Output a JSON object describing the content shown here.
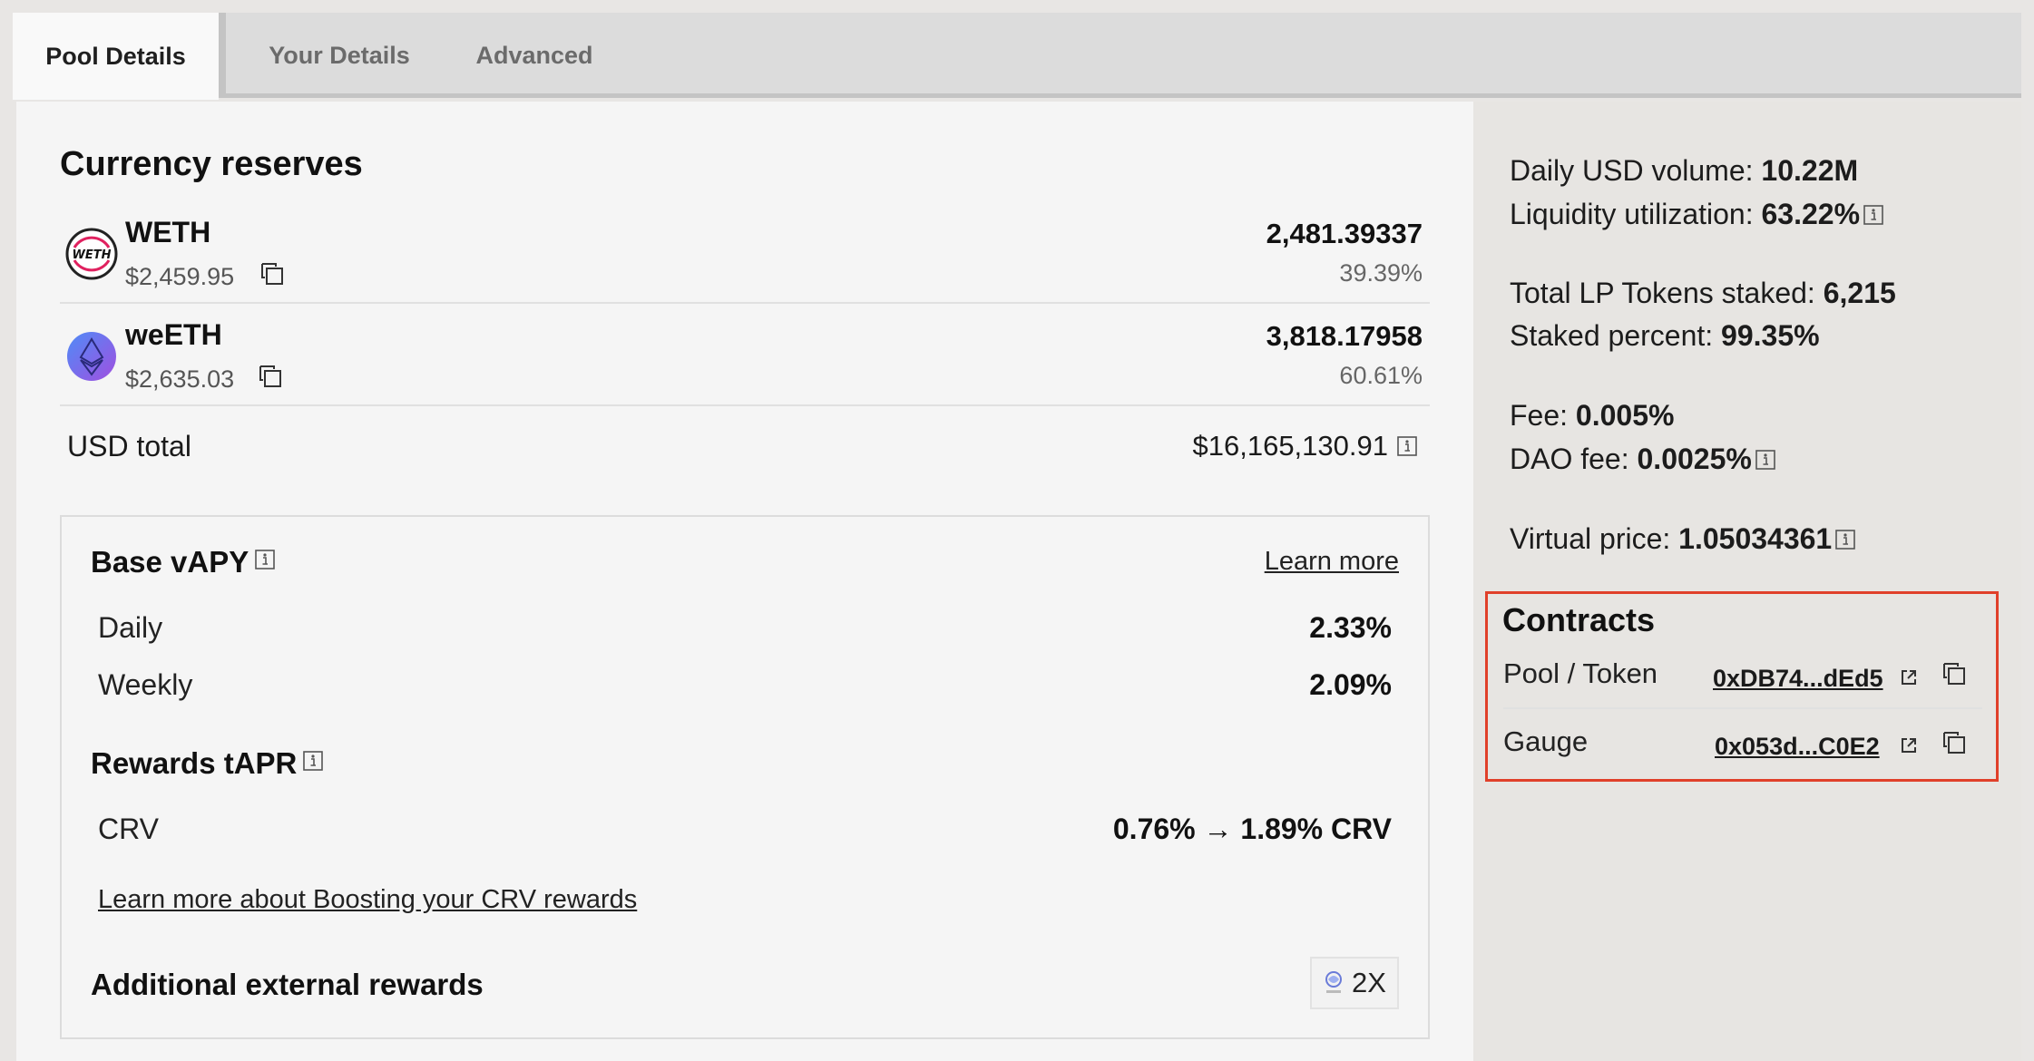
{
  "tabs": [
    {
      "label": "Pool Details",
      "active": true
    },
    {
      "label": "Your Details",
      "active": false
    },
    {
      "label": "Advanced",
      "active": false
    }
  ],
  "reserves": {
    "title": "Currency reserves",
    "coins": [
      {
        "symbol": "WETH",
        "logo_text": "WETH",
        "usd_price": "$2,459.95",
        "amount": "2,481.39337",
        "percent": "39.39%"
      },
      {
        "symbol": "weETH",
        "usd_price": "$2,635.03",
        "amount": "3,818.17958",
        "percent": "60.61%"
      }
    ],
    "usd_total_label": "USD total",
    "usd_total_value": "$16,165,130.91"
  },
  "base_vapy": {
    "title": "Base vAPY",
    "learn_more": "Learn more",
    "rows": [
      {
        "label": "Daily",
        "value": "2.33%"
      },
      {
        "label": "Weekly",
        "value": "2.09%"
      }
    ]
  },
  "rewards_tapr": {
    "title": "Rewards tAPR",
    "rows": [
      {
        "label": "CRV",
        "value": "0.76% → 1.89% CRV"
      }
    ],
    "boost_link": "Learn more about Boosting your CRV rewards"
  },
  "external_rewards": {
    "title": "Additional external rewards",
    "badge": "2X"
  },
  "stats": {
    "daily_volume_label": "Daily USD volume:",
    "daily_volume_value": "10.22M",
    "liquidity_util_label": "Liquidity utilization:",
    "liquidity_util_value": "63.22%",
    "lp_staked_label": "Total LP Tokens staked:",
    "lp_staked_value": "6,215",
    "staked_pct_label": "Staked percent:",
    "staked_pct_value": "99.35%",
    "fee_label": "Fee:",
    "fee_value": "0.005%",
    "dao_fee_label": "DAO fee:",
    "dao_fee_value": "0.0025%",
    "virtual_price_label": "Virtual price:",
    "virtual_price_value": "1.05034361"
  },
  "contracts": {
    "title": "Contracts",
    "items": [
      {
        "label": "Pool / Token",
        "address": "0xDB74...dEd5"
      },
      {
        "label": "Gauge",
        "address": "0x053d...C0E2"
      }
    ]
  },
  "colors": {
    "highlight_border": "#e0402a",
    "left_panel_bg": "#f5f5f5",
    "right_panel_bg": "#e7e5e2"
  },
  "icons": [
    "copy-icon",
    "info-icon",
    "external-link-icon",
    "weth-logo",
    "weeth-logo",
    "reward-token-icon"
  ]
}
